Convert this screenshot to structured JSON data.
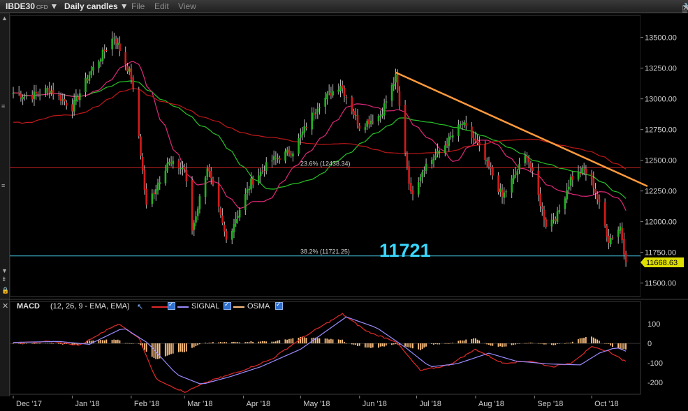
{
  "toolbar": {
    "symbol": "IBDE30",
    "symbol_type": "CFD",
    "timeframe": "Daily candles",
    "menu_file": "File",
    "menu_edit": "Edit",
    "menu_view": "View"
  },
  "colors": {
    "background": "#000000",
    "up_candle": "#21b321",
    "down_candle": "#d11b1b",
    "price_tag": "#e0e000",
    "trendline": "#ff9a3c",
    "fib_382": "#42c6e0",
    "fib_236": "#c02020",
    "ma_fast": "#e0287a",
    "ma_mid": "#27c227",
    "ma_slow": "#c01818",
    "macd_line": "#e02a2a",
    "signal_line": "#9a8cff",
    "osma": "#ffc080"
  },
  "chart_data": [
    {
      "type": "candlestick",
      "title": "IBDE30 CFD Daily candles",
      "x_ticks": [
        "Dec '17",
        "Jan '18",
        "Feb '18",
        "Mar '18",
        "Apr '18",
        "May '18",
        "Jun '18",
        "Jul '18",
        "Aug '18",
        "Sep '18",
        "Oct '18"
      ],
      "y_ticks": [
        13500,
        13250,
        13000,
        12750,
        12500,
        12250,
        12000,
        11750,
        11500
      ],
      "y_tick_labels": [
        "13500.00",
        "13250.00",
        "13000.00",
        "12750.00",
        "12500.00",
        "12250.00",
        "12000.00",
        "11750.00",
        "11500.00"
      ],
      "ylim": [
        11390,
        13680
      ],
      "last_price": 11668.63,
      "last_price_label": "11668.63",
      "annotation_big": "11721",
      "fib_levels": [
        {
          "label": "23.6% (12438.34)",
          "value": 12438.34
        },
        {
          "label": "38.2% (11721.25)",
          "value": 11721.25
        }
      ],
      "trendline": {
        "from": {
          "date": "2018-06-20",
          "price": 13215
        },
        "to": {
          "date": "2018-10-23",
          "price": 12340
        }
      },
      "closes_keypoints": [
        [
          "2017-12-01",
          13050
        ],
        [
          "2017-12-10",
          13020
        ],
        [
          "2017-12-20",
          13080
        ],
        [
          "2018-01-01",
          12930
        ],
        [
          "2018-01-10",
          13200
        ],
        [
          "2018-01-23",
          13510
        ],
        [
          "2018-02-01",
          13180
        ],
        [
          "2018-02-05",
          12700
        ],
        [
          "2018-02-09",
          12120
        ],
        [
          "2018-02-20",
          12480
        ],
        [
          "2018-03-01",
          12430
        ],
        [
          "2018-03-05",
          11930
        ],
        [
          "2018-03-13",
          12450
        ],
        [
          "2018-03-23",
          11850
        ],
        [
          "2018-04-05",
          12320
        ],
        [
          "2018-04-16",
          12500
        ],
        [
          "2018-04-27",
          12580
        ],
        [
          "2018-05-10",
          12950
        ],
        [
          "2018-05-22",
          13120
        ],
        [
          "2018-06-01",
          12780
        ],
        [
          "2018-06-12",
          12870
        ],
        [
          "2018-06-20",
          13170
        ],
        [
          "2018-06-28",
          12220
        ],
        [
          "2018-07-05",
          12450
        ],
        [
          "2018-07-12",
          12550
        ],
        [
          "2018-07-25",
          12800
        ],
        [
          "2018-08-02",
          12620
        ],
        [
          "2018-08-10",
          12380
        ],
        [
          "2018-08-15",
          12200
        ],
        [
          "2018-08-28",
          12550
        ],
        [
          "2018-09-07",
          11980
        ],
        [
          "2018-09-13",
          12050
        ],
        [
          "2018-09-20",
          12350
        ],
        [
          "2018-09-27",
          12420
        ],
        [
          "2018-10-02",
          12300
        ],
        [
          "2018-10-10",
          11850
        ],
        [
          "2018-10-16",
          11960
        ],
        [
          "2018-10-19",
          11668.63
        ]
      ]
    },
    {
      "type": "line",
      "title": "MACD",
      "params": "(12, 26, 9 - EMA, EMA)",
      "series_names": [
        "SIGNAL",
        "OSMA"
      ],
      "y_ticks": [
        100,
        0,
        -100,
        -200
      ],
      "y_tick_labels": [
        "100",
        "0",
        "-100",
        "-200"
      ],
      "ylim": [
        -260,
        150
      ],
      "macd_keypoints": [
        [
          "2017-12-01",
          0
        ],
        [
          "2017-12-20",
          10
        ],
        [
          "2018-01-05",
          -10
        ],
        [
          "2018-01-25",
          100
        ],
        [
          "2018-02-05",
          30
        ],
        [
          "2018-02-14",
          -180
        ],
        [
          "2018-03-01",
          -250
        ],
        [
          "2018-03-15",
          -190
        ],
        [
          "2018-03-28",
          -150
        ],
        [
          "2018-04-16",
          -80
        ],
        [
          "2018-05-02",
          30
        ],
        [
          "2018-05-23",
          150
        ],
        [
          "2018-06-05",
          60
        ],
        [
          "2018-06-20",
          10
        ],
        [
          "2018-07-03",
          -140
        ],
        [
          "2018-07-18",
          -110
        ],
        [
          "2018-08-01",
          -30
        ],
        [
          "2018-08-15",
          -100
        ],
        [
          "2018-08-30",
          -90
        ],
        [
          "2018-09-10",
          -120
        ],
        [
          "2018-09-20",
          -100
        ],
        [
          "2018-10-01",
          -20
        ],
        [
          "2018-10-10",
          -40
        ],
        [
          "2018-10-19",
          -95
        ]
      ],
      "signal_keypoints": [
        [
          "2017-12-01",
          5
        ],
        [
          "2017-12-25",
          10
        ],
        [
          "2018-01-10",
          -5
        ],
        [
          "2018-01-28",
          80
        ],
        [
          "2018-02-10",
          0
        ],
        [
          "2018-02-25",
          -160
        ],
        [
          "2018-03-10",
          -210
        ],
        [
          "2018-03-25",
          -170
        ],
        [
          "2018-04-10",
          -120
        ],
        [
          "2018-05-01",
          -30
        ],
        [
          "2018-05-25",
          135
        ],
        [
          "2018-06-10",
          80
        ],
        [
          "2018-06-25",
          -20
        ],
        [
          "2018-07-08",
          -120
        ],
        [
          "2018-07-22",
          -105
        ],
        [
          "2018-08-08",
          -50
        ],
        [
          "2018-08-22",
          -90
        ],
        [
          "2018-09-08",
          -105
        ],
        [
          "2018-09-25",
          -110
        ],
        [
          "2018-10-05",
          -50
        ],
        [
          "2018-10-14",
          -20
        ],
        [
          "2018-10-19",
          -40
        ]
      ]
    }
  ]
}
